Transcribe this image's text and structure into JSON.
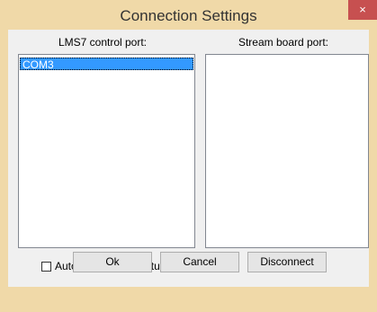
{
  "window": {
    "title": "Connection Settings",
    "close_glyph": "×"
  },
  "lms_port": {
    "label": "LMS7 control port:",
    "items": [
      "COM3"
    ],
    "selected_index": 0
  },
  "stream_port": {
    "label": "Stream board port:",
    "items": []
  },
  "auto_connect": {
    "label": "Auto connect at startup",
    "checked": false
  },
  "buttons": {
    "ok": "Ok",
    "cancel": "Cancel",
    "disconnect": "Disconnect"
  }
}
